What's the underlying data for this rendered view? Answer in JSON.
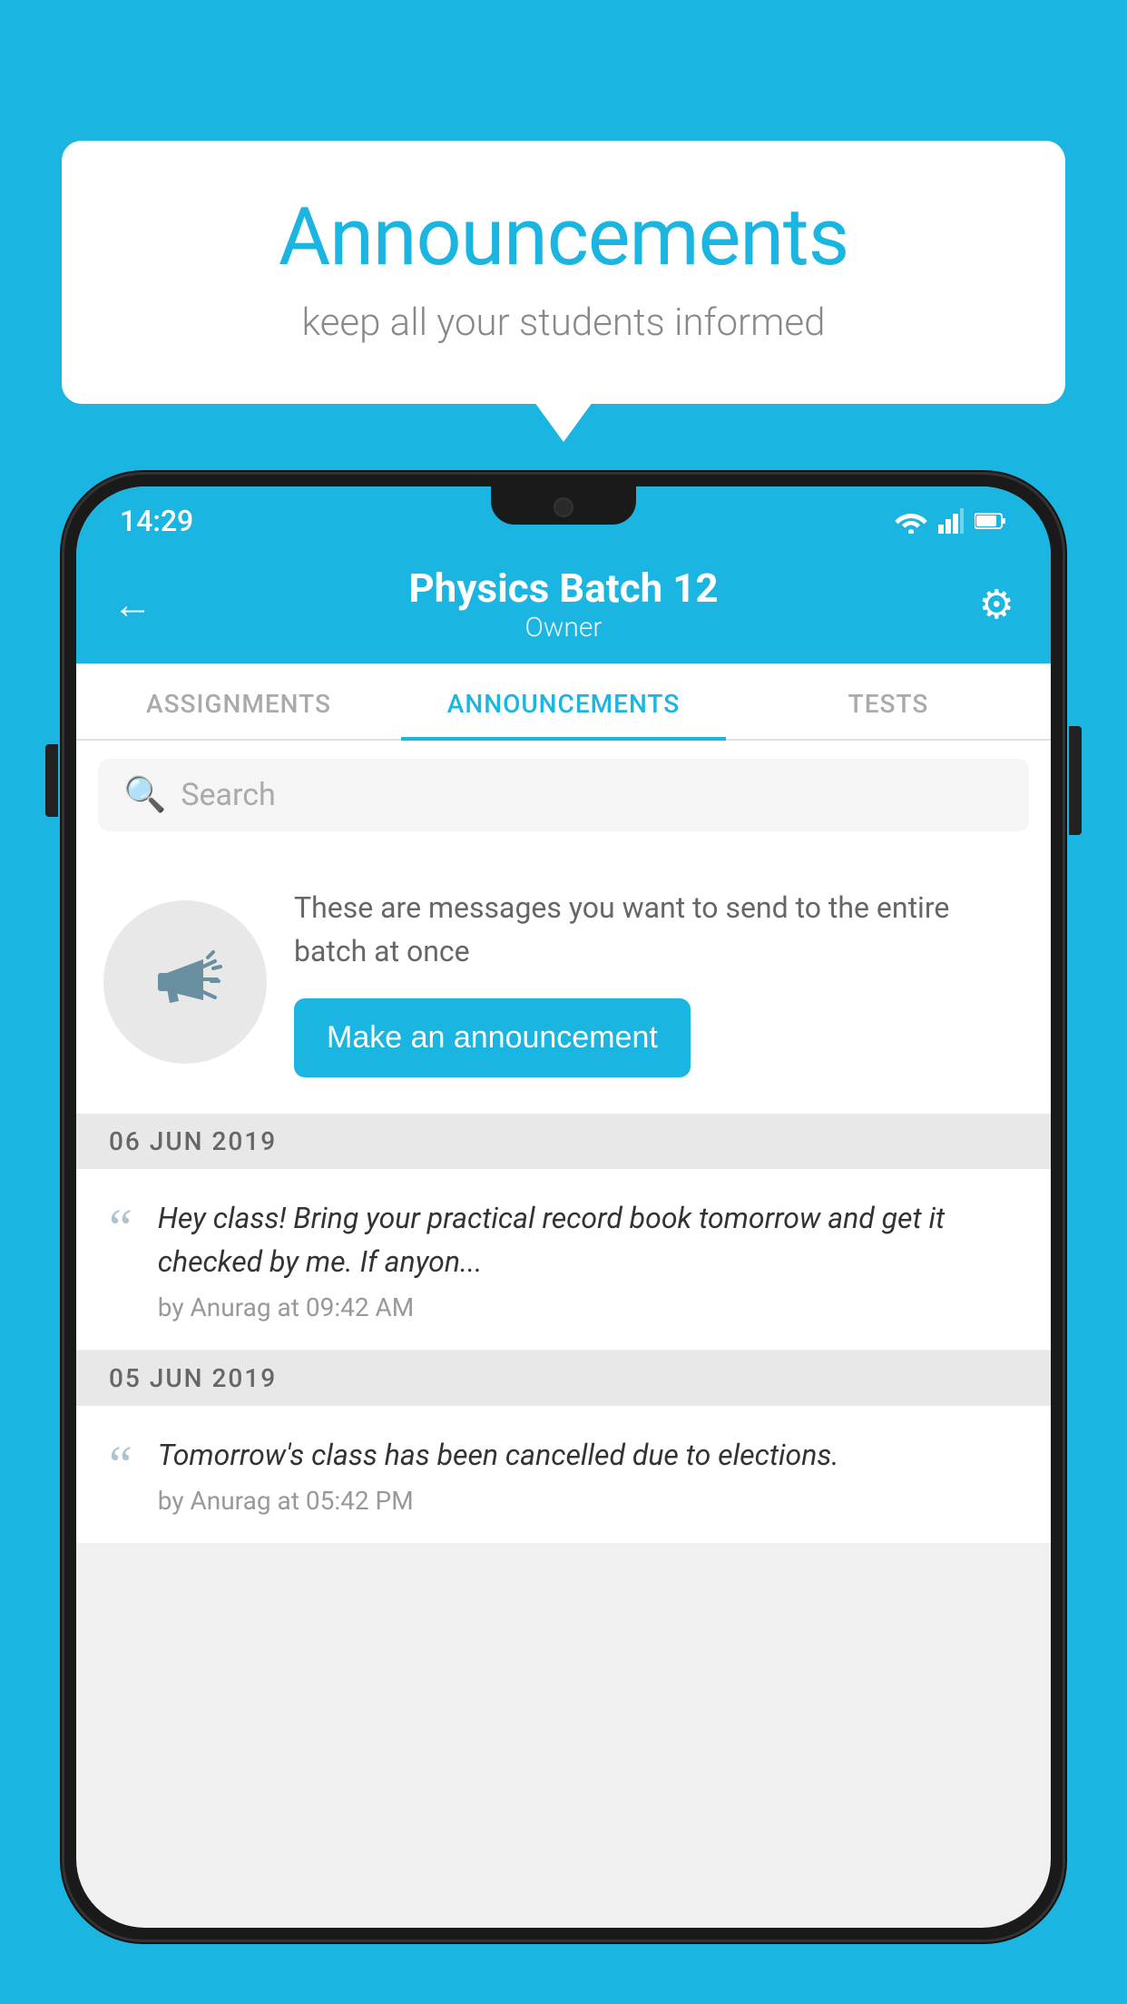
{
  "background_color": "#1ab5e0",
  "speech_bubble": {
    "title": "Announcements",
    "subtitle": "keep all your students informed"
  },
  "status_bar": {
    "time": "14:29"
  },
  "header": {
    "title": "Physics Batch 12",
    "subtitle": "Owner",
    "back_label": "←",
    "gear_label": "⚙"
  },
  "tabs": [
    {
      "label": "ASSIGNMENTS",
      "active": false
    },
    {
      "label": "ANNOUNCEMENTS",
      "active": true
    },
    {
      "label": "TESTS",
      "active": false
    }
  ],
  "search": {
    "placeholder": "Search"
  },
  "promo": {
    "message": "These are messages you want to send to the entire batch at once",
    "button_label": "Make an announcement"
  },
  "announcements": [
    {
      "date": "06  JUN  2019",
      "text": "Hey class! Bring your practical record book tomorrow and get it checked by me. If anyon...",
      "meta": "by Anurag at 09:42 AM"
    },
    {
      "date": "05  JUN  2019",
      "text": "Tomorrow's class has been cancelled due to elections.",
      "meta": "by Anurag at 05:42 PM"
    }
  ]
}
